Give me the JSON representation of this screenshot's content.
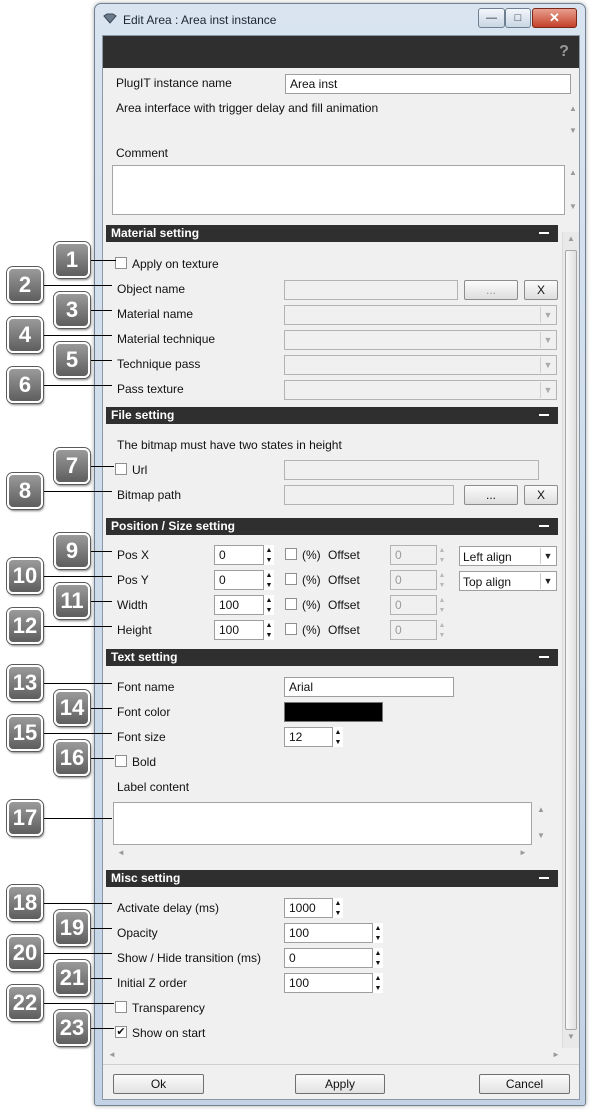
{
  "window": {
    "title": "Edit Area : Area inst instance",
    "controls": {
      "minimize": "—",
      "maximize": "□",
      "close": "✕"
    },
    "help_glyph": "?"
  },
  "header": {
    "instance_name_label": "PlugIT instance name",
    "instance_name_value": "Area inst",
    "description": "Area interface with trigger delay and fill animation",
    "comment_label": "Comment",
    "comment_value": ""
  },
  "material": {
    "title": "Material setting",
    "apply_texture_label": "Apply on texture",
    "apply_texture_checked": false,
    "object_name_label": "Object name",
    "object_name_value": "",
    "browse_label": "...",
    "clear_label": "X",
    "material_name_label": "Material name",
    "material_technique_label": "Material technique",
    "technique_pass_label": "Technique pass",
    "pass_texture_label": "Pass texture"
  },
  "file": {
    "title": "File setting",
    "note": "The bitmap must have two states in height",
    "url_label": "Url",
    "url_checked": false,
    "url_value": "",
    "bitmap_label": "Bitmap path",
    "bitmap_value": "",
    "browse_label": "...",
    "clear_label": "X"
  },
  "position": {
    "title": "Position / Size setting",
    "percent_label": "(%)",
    "offset_label": "Offset",
    "rows": [
      {
        "label": "Pos X",
        "value": "0",
        "offset": "0"
      },
      {
        "label": "Pos Y",
        "value": "0",
        "offset": "0"
      },
      {
        "label": "Width",
        "value": "100",
        "offset": "0"
      },
      {
        "label": "Height",
        "value": "100",
        "offset": "0"
      }
    ],
    "h_align": "Left align",
    "v_align": "Top align"
  },
  "text": {
    "title": "Text setting",
    "font_name_label": "Font name",
    "font_name_value": "Arial",
    "font_color_label": "Font color",
    "font_color_value": "#000000",
    "font_size_label": "Font size",
    "font_size_value": "12",
    "bold_label": "Bold",
    "bold_checked": false,
    "label_content_label": "Label content",
    "label_content_value": ""
  },
  "misc": {
    "title": "Misc setting",
    "activate_delay_label": "Activate delay (ms)",
    "activate_delay_value": "1000",
    "opacity_label": "Opacity",
    "opacity_value": "100",
    "transition_label": "Show / Hide transition (ms)",
    "transition_value": "0",
    "z_order_label": "Initial Z order",
    "z_order_value": "100",
    "transparency_label": "Transparency",
    "transparency_checked": false,
    "show_on_start_label": "Show on start",
    "show_on_start_checked": true
  },
  "footer": {
    "ok": "Ok",
    "apply": "Apply",
    "cancel": "Cancel"
  },
  "callouts": [
    "1",
    "2",
    "3",
    "4",
    "5",
    "6",
    "7",
    "8",
    "9",
    "10",
    "11",
    "12",
    "13",
    "14",
    "15",
    "16",
    "17",
    "18",
    "19",
    "20",
    "21",
    "22",
    "23"
  ],
  "icons": {
    "check_glyph": "✔",
    "dropdown_glyph": "▼",
    "spin_up_glyph": "▲",
    "spin_down_glyph": "▼",
    "scroll_up_glyph": "▲",
    "scroll_down_glyph": "▼",
    "scroll_left_glyph": "◄",
    "scroll_right_glyph": "►"
  }
}
